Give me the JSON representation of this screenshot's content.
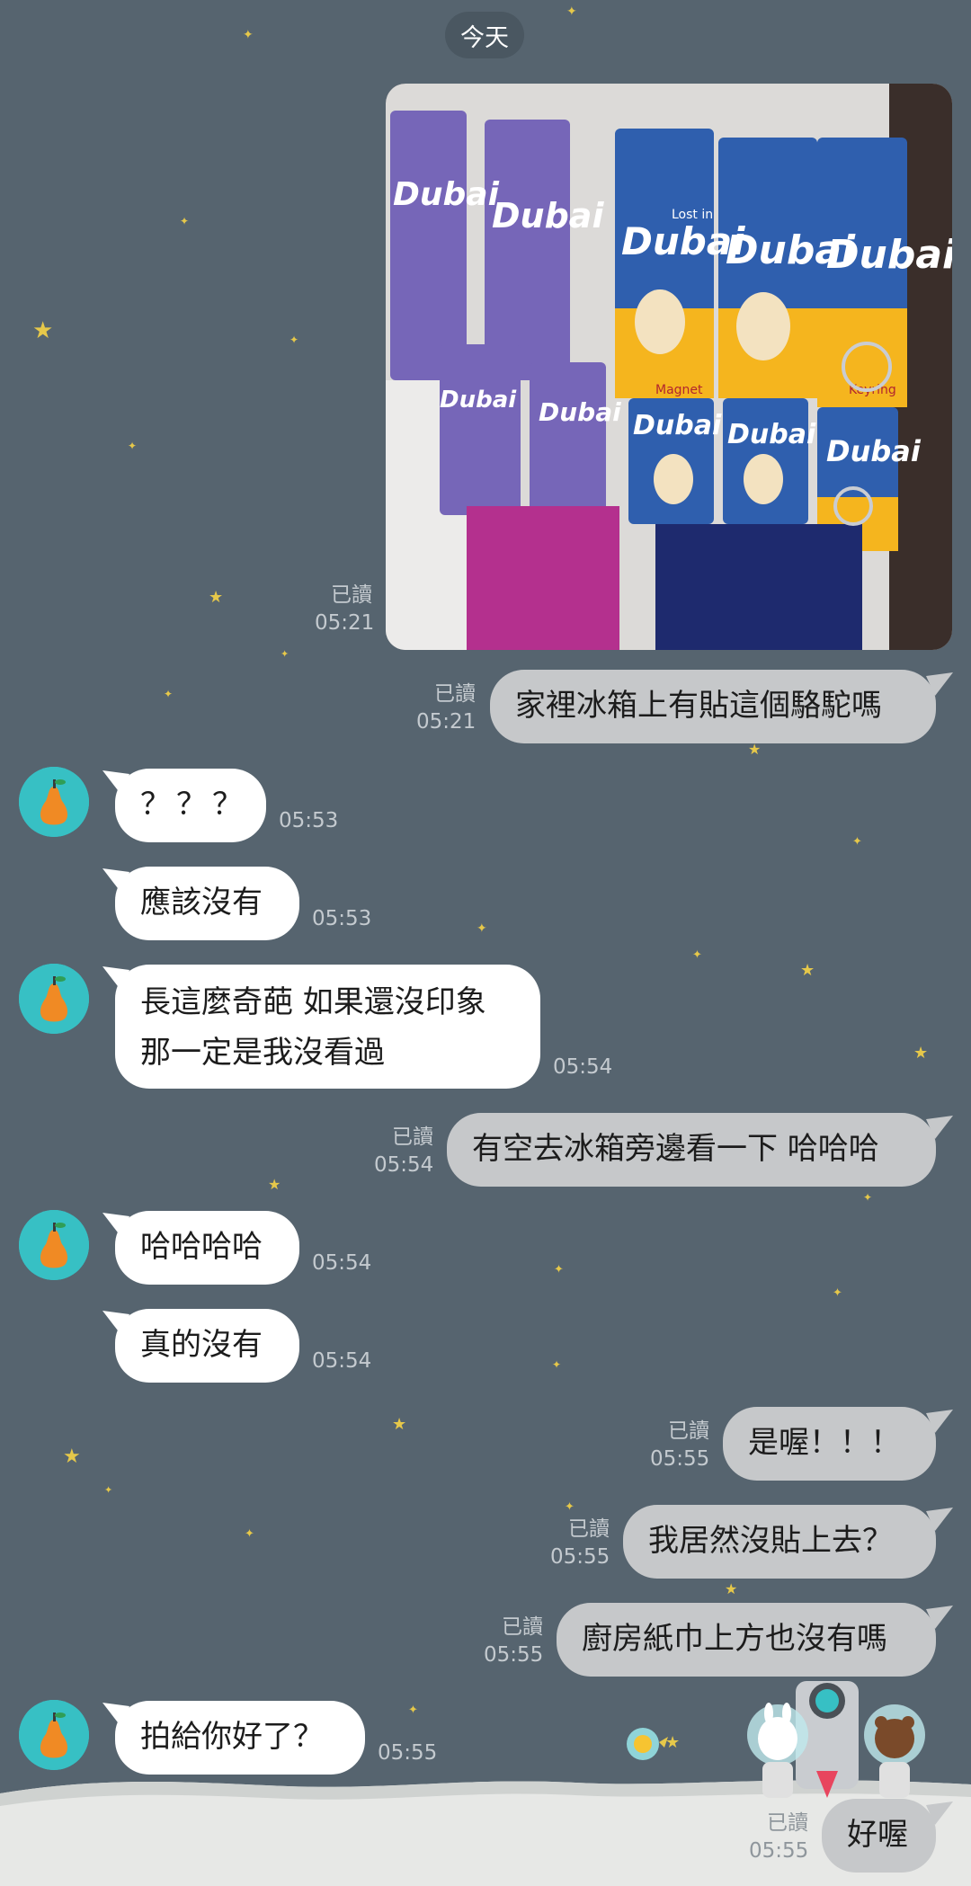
{
  "date_divider": "今天",
  "colors": {
    "background": "#56646f",
    "incoming_bubble": "#ffffff",
    "outgoing_bubble": "#c6c8ca",
    "avatar": "#37c0c4",
    "star": "#e6c84a"
  },
  "icons": {
    "avatar": "pear-avatar-icon",
    "sticker": "astronaut-sticker-icon"
  },
  "messages": [
    {
      "dir": "out",
      "type": "image",
      "image_desc": "Dubai souvenir magnets and keyrings",
      "read": "已讀",
      "time": "05:21"
    },
    {
      "dir": "out",
      "text": "家裡冰箱上有貼這個駱駝嗎",
      "read": "已讀",
      "time": "05:21"
    },
    {
      "dir": "in",
      "text": "？？？",
      "time": "05:53"
    },
    {
      "dir": "in",
      "text": "應該沒有",
      "time": "05:53"
    },
    {
      "dir": "in",
      "line1": "長這麼奇葩 如果還沒印象",
      "line2": "那一定是我沒看過",
      "time": "05:54"
    },
    {
      "dir": "out",
      "text": "有空去冰箱旁邊看一下 哈哈哈",
      "read": "已讀",
      "time": "05:54"
    },
    {
      "dir": "in",
      "text": "哈哈哈哈",
      "time": "05:54"
    },
    {
      "dir": "in",
      "text": "真的沒有",
      "time": "05:54"
    },
    {
      "dir": "out",
      "text": "是喔！！！",
      "read": "已讀",
      "time": "05:55"
    },
    {
      "dir": "out",
      "text": "我居然沒貼上去？",
      "read": "已讀",
      "time": "05:55"
    },
    {
      "dir": "out",
      "text": "廚房紙巾上方也沒有嗎",
      "read": "已讀",
      "time": "05:55"
    },
    {
      "dir": "in",
      "text": "拍給你好了？",
      "time": "05:55"
    },
    {
      "dir": "out",
      "text": "好喔",
      "read": "已讀",
      "time": "05:55"
    }
  ],
  "photo_text": {
    "brand": "Dubai",
    "tagline": "Lost in",
    "label_magnet": "Magnet",
    "label_keyring": "Keyring"
  }
}
